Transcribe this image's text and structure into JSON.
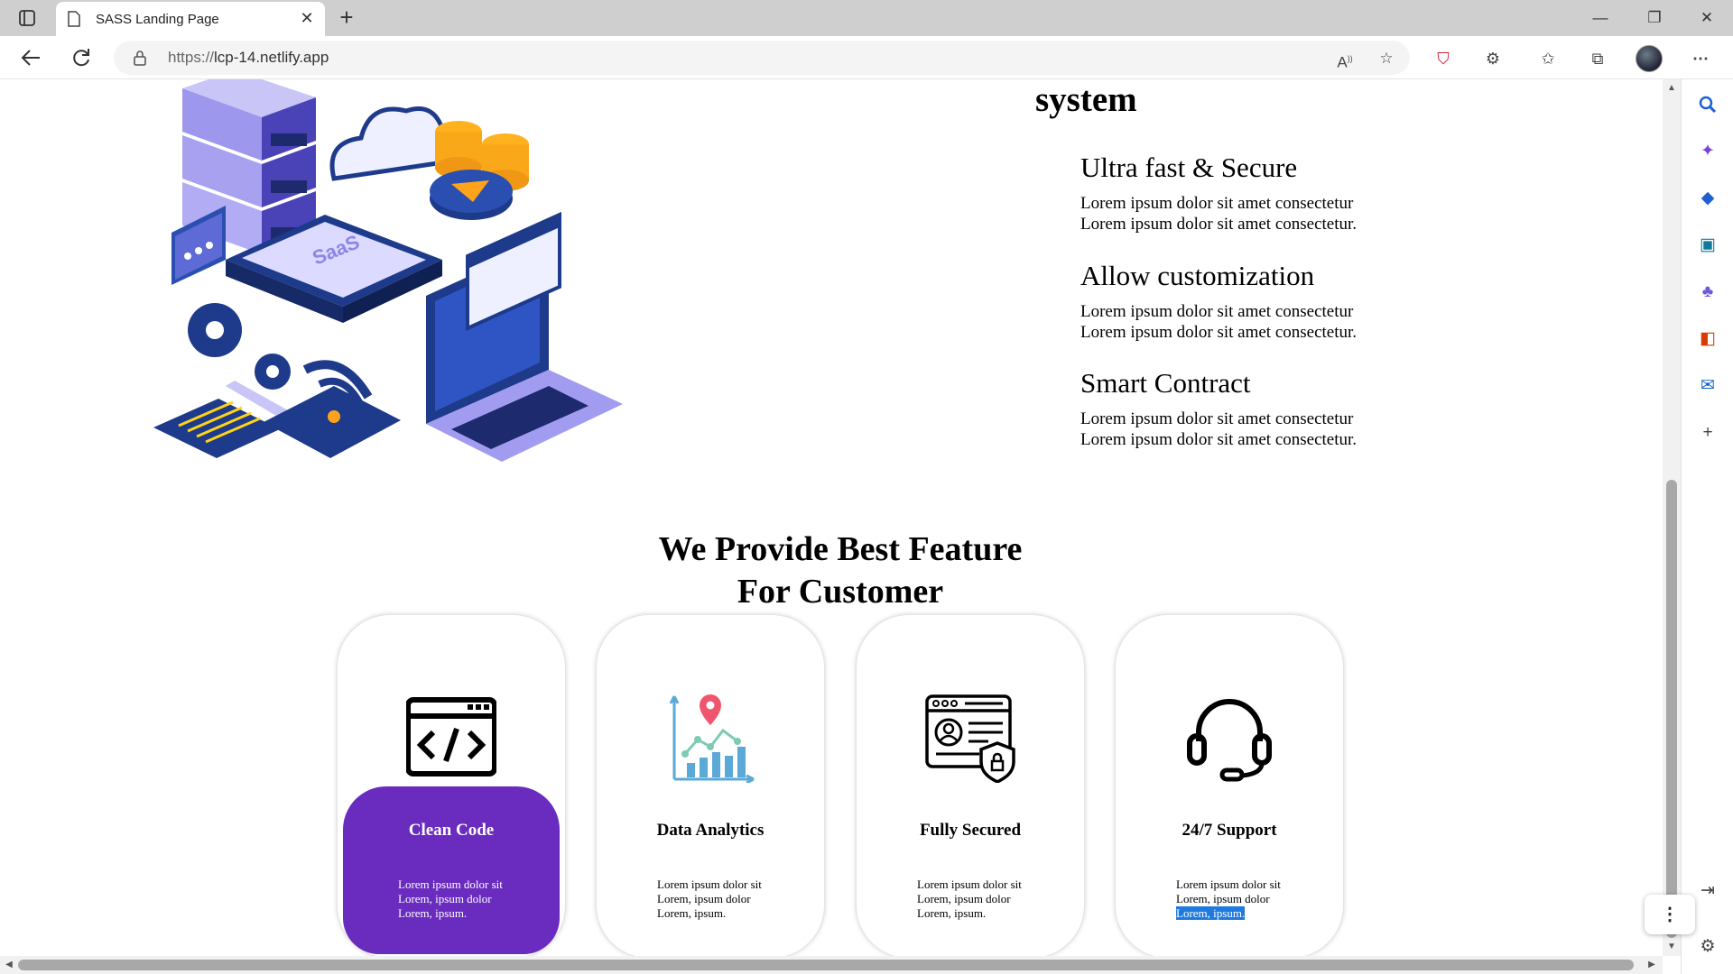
{
  "browser": {
    "tab_title": "SASS Landing Page",
    "url_protocol": "https://",
    "url_host": "lcp-14.netlify.app"
  },
  "page": {
    "system_heading": "system",
    "features": [
      {
        "title": "Ultra fast & Secure",
        "line1": "Lorem ipsum dolor sit amet consectetur",
        "line2": "Lorem ipsum dolor sit amet consectetur."
      },
      {
        "title": "Allow customization",
        "line1": "Lorem ipsum dolor sit amet consectetur",
        "line2": "Lorem ipsum dolor sit amet consectetur."
      },
      {
        "title": "Smart Contract",
        "line1": "Lorem ipsum dolor sit amet consectetur",
        "line2": "Lorem ipsum dolor sit amet consectetur."
      }
    ],
    "section_title_line1": "We Provide Best Feature",
    "section_title_line2": "For Customer",
    "cards": [
      {
        "title": "Clean Code",
        "icon": "code-window-icon",
        "line1": "Lorem ipsum dolor sit",
        "line2": "Lorem, ipsum dolor",
        "line3": "Lorem, ipsum."
      },
      {
        "title": "Data Analytics",
        "icon": "analytics-chart-icon",
        "line1": "Lorem ipsum dolor sit",
        "line2": "Lorem, ipsum dolor",
        "line3": "Lorem, ipsum."
      },
      {
        "title": "Fully Secured",
        "icon": "secure-profile-icon",
        "line1": "Lorem ipsum dolor sit",
        "line2": "Lorem, ipsum dolor",
        "line3": "Lorem, ipsum."
      },
      {
        "title": "24/7 Support",
        "icon": "headset-icon",
        "line1": "Lorem ipsum dolor sit",
        "line2": "Lorem, ipsum dolor",
        "line3": "Lorem, ipsum."
      }
    ],
    "active_card_color": "#6a2bbf",
    "selection_color": "#1f7ae0"
  }
}
